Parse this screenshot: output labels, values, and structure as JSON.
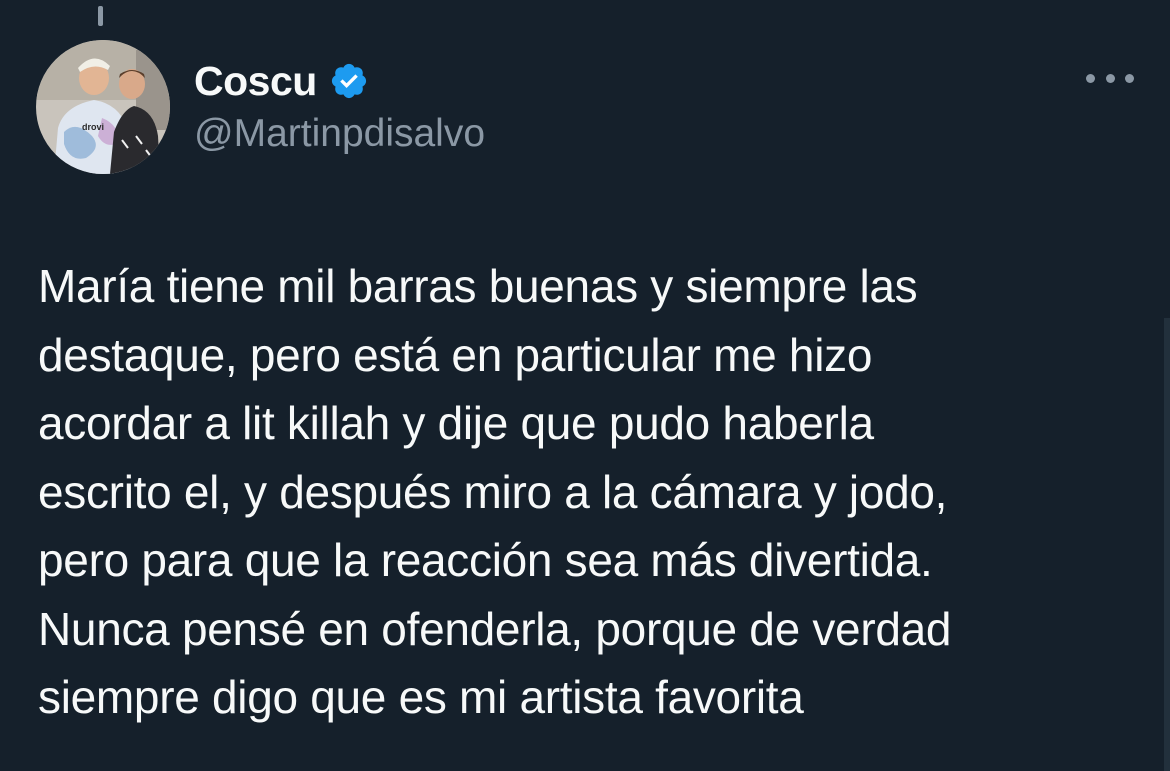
{
  "tweet": {
    "author": {
      "display_name": "Coscu",
      "handle": "@Martinpdisalvo",
      "verified": true,
      "avatar_shirt_text": "drovi"
    },
    "text_lines": [
      "María tiene mil barras buenas y siempre las",
      "destaque, pero está en particular me hizo",
      "acordar a lit killah y dije que pudo haberla",
      "escrito el, y después miro a la cámara y jodo,",
      "pero para que la reacción sea más divertida.",
      "Nunca pensé en ofenderla, porque de verdad",
      "siempre digo que es mi artista favorita"
    ]
  },
  "icons": {
    "verified": "verified-badge-icon",
    "more": "more-options-icon"
  },
  "colors": {
    "background": "#15202b",
    "text_primary": "#f7f9f9",
    "text_secondary": "#8b98a5",
    "verified_blue": "#1d9bf0"
  }
}
